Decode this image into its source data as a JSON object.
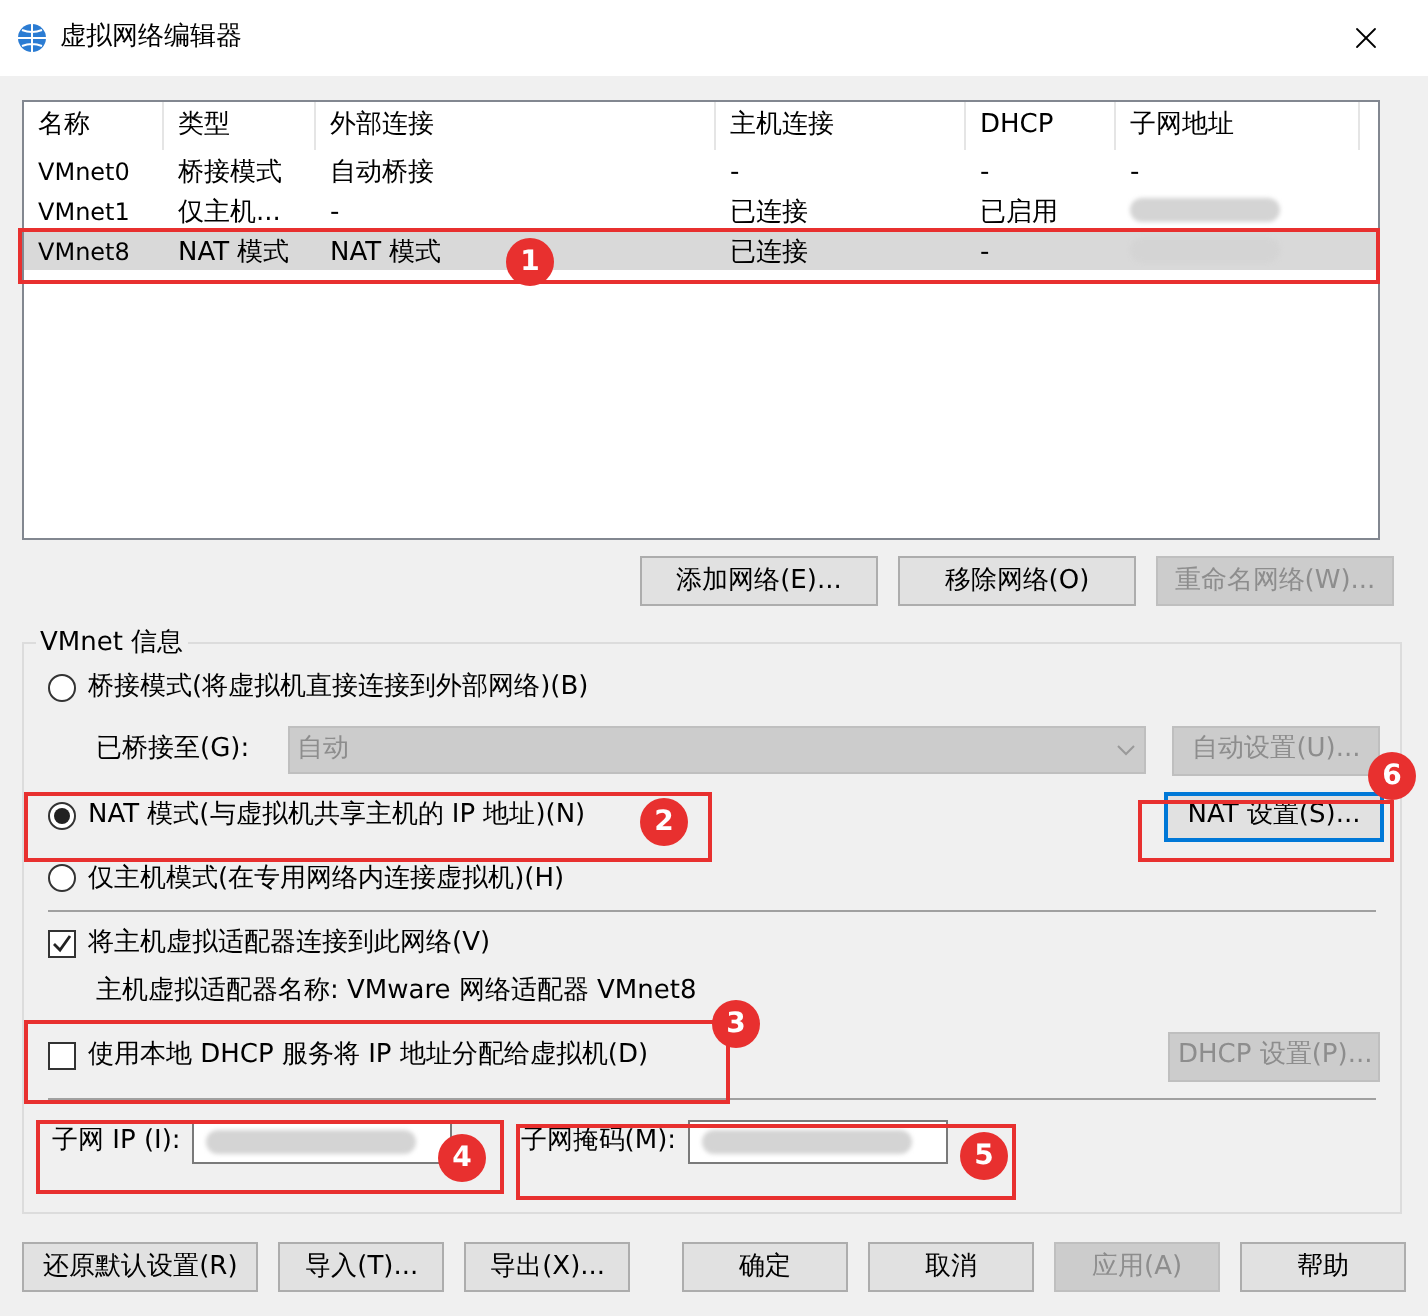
{
  "window": {
    "title": "虚拟网络编辑器"
  },
  "table": {
    "columns": [
      "名称",
      "类型",
      "外部连接",
      "主机连接",
      "DHCP",
      "子网地址"
    ],
    "rows": [
      {
        "cells": [
          "VMnet0",
          "桥接模式",
          "自动桥接",
          "-",
          "-",
          "-"
        ],
        "subnet_blurred": false,
        "selected": false
      },
      {
        "cells": [
          "VMnet1",
          "仅主机...",
          "-",
          "已连接",
          "已启用"
        ],
        "subnet_blurred": true,
        "selected": false
      },
      {
        "cells": [
          "VMnet8",
          "NAT 模式",
          "NAT 模式",
          "已连接",
          "-"
        ],
        "subnet_blurred": true,
        "selected": true
      }
    ]
  },
  "table_buttons": [
    {
      "label": "添加网络(E)...",
      "disabled": false
    },
    {
      "label": "移除网络(O)",
      "disabled": false
    },
    {
      "label": "重命名网络(W)...",
      "disabled": true
    }
  ],
  "vmnet_info": {
    "title": "VMnet 信息",
    "modes": [
      {
        "label": "桥接模式(将虚拟机直接连接到外部网络)(B)",
        "selected": false
      },
      {
        "label": "NAT 模式(与虚拟机共享主机的 IP 地址)(N)",
        "selected": true
      },
      {
        "label": "仅主机模式(在专用网络内连接虚拟机)(H)",
        "selected": false
      }
    ],
    "bridge_to": {
      "label": "已桥接至(G):",
      "value": "自动",
      "disabled": true
    },
    "auto_button": {
      "label": "自动设置(U)...",
      "disabled": true
    },
    "nat_button": {
      "label": "NAT 设置(S)...",
      "disabled": false,
      "focused": true
    },
    "connect_adapter": {
      "label": "将主机虚拟适配器连接到此网络(V)",
      "checked": true
    },
    "adapter_name": "主机虚拟适配器名称: VMware 网络适配器 VMnet8",
    "use_dhcp": {
      "label": "使用本地 DHCP 服务将 IP 地址分配给虚拟机(D)",
      "checked": false
    },
    "dhcp_button": {
      "label": "DHCP 设置(P)...",
      "disabled": true
    },
    "subnet_ip": {
      "label": "子网 IP (I):",
      "blurred": true
    },
    "subnet_mask": {
      "label": "子网掩码(M):",
      "blurred": true
    }
  },
  "footer_buttons": [
    {
      "label": "还原默认设置(R)",
      "disabled": false
    },
    {
      "label": "导入(T)...",
      "disabled": false
    },
    {
      "label": "导出(X)...",
      "disabled": false
    },
    {
      "label": "确定",
      "disabled": false
    },
    {
      "label": "取消",
      "disabled": false
    },
    {
      "label": "应用(A)",
      "disabled": true
    },
    {
      "label": "帮助",
      "disabled": false
    }
  ],
  "annotations": [
    {
      "number": "1"
    },
    {
      "number": "2"
    },
    {
      "number": "3"
    },
    {
      "number": "4"
    },
    {
      "number": "5"
    },
    {
      "number": "6"
    }
  ]
}
